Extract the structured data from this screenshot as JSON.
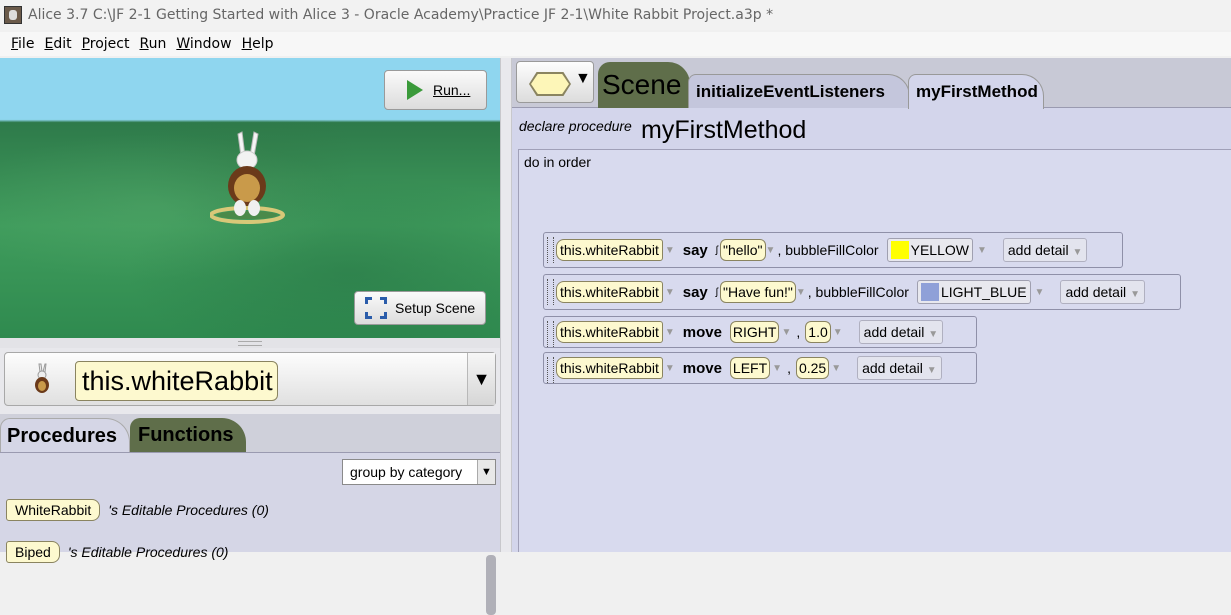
{
  "window": {
    "title": "Alice 3.7 C:\\JF 2-1 Getting Started with Alice 3  - Oracle Academy\\Practice JF 2-1\\White Rabbit Project.a3p *"
  },
  "menu": [
    {
      "first": "F",
      "rest": "ile"
    },
    {
      "first": "E",
      "rest": "dit"
    },
    {
      "first": "P",
      "rest": "roject"
    },
    {
      "first": "R",
      "rest": "un"
    },
    {
      "first": "W",
      "rest": "indow"
    },
    {
      "first": "H",
      "rest": "elp"
    }
  ],
  "scene": {
    "run_label": "Run...",
    "setup_label": "Setup Scene"
  },
  "selector": {
    "value": "this.whiteRabbit"
  },
  "left_tabs": {
    "procedures": "Procedures",
    "functions": "Functions"
  },
  "group_by": "group by category",
  "class_rows": [
    {
      "class_name": "WhiteRabbit",
      "suffix": "'s Editable Procedures (0)"
    },
    {
      "class_name": "Biped",
      "suffix": "'s Editable Procedures (0)"
    }
  ],
  "editor_tabs": {
    "scene": "Scene",
    "init": "initializeEventListeners",
    "method": "myFirstMethod"
  },
  "declare": {
    "label": "declare procedure",
    "name": "myFirstMethod"
  },
  "do_in_order": "do in order",
  "statements": [
    {
      "target": "this.whiteRabbit",
      "verb": "say",
      "arg": "\"hello\"",
      "param_label": ", bubbleFillColor",
      "color_name": "YELLOW",
      "add_detail": "add detail"
    },
    {
      "target": "this.whiteRabbit",
      "verb": "say",
      "arg": "\"Have fun!\"",
      "param_label": ", bubbleFillColor",
      "color_name": "LIGHT_BLUE",
      "add_detail": "add detail"
    },
    {
      "target": "this.whiteRabbit",
      "verb": "move",
      "dir": "RIGHT",
      "amount": "1.0",
      "add_detail": "add detail"
    },
    {
      "target": "this.whiteRabbit",
      "verb": "move",
      "dir": "LEFT",
      "amount": "0.25",
      "add_detail": "add detail"
    }
  ],
  "colors": {
    "yellow_swatch": "#ffff00",
    "light_blue_swatch": "#8fa0d8",
    "functions_tab": "#5f6e4a",
    "editor_bg": "#d3d5eb"
  }
}
